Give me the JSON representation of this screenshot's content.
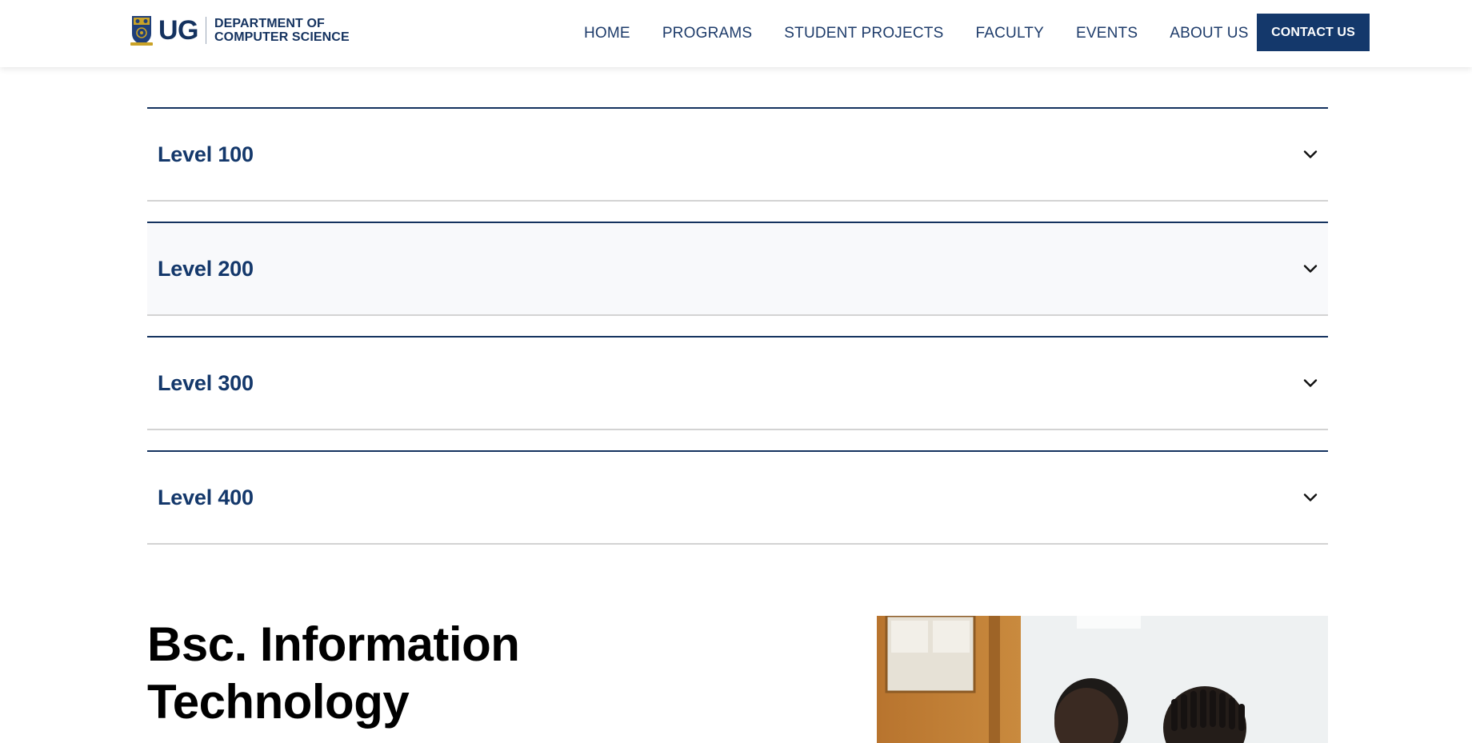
{
  "header": {
    "logo": {
      "abbr": "UG",
      "line1": "DEPARTMENT OF",
      "line2": "COMPUTER SCIENCE",
      "crest_icon": "university-crest-icon"
    },
    "nav": [
      {
        "label": "HOME"
      },
      {
        "label": "PROGRAMS"
      },
      {
        "label": "STUDENT PROJECTS"
      },
      {
        "label": "FACULTY"
      },
      {
        "label": "EVENTS"
      },
      {
        "label": "ABOUT US"
      }
    ],
    "cta_label": "CONTACT US"
  },
  "accordion": {
    "items": [
      {
        "label": "Level 100",
        "icon": "chevron-down-icon"
      },
      {
        "label": "Level 200",
        "icon": "chevron-down-icon"
      },
      {
        "label": "Level 300",
        "icon": "chevron-down-icon"
      },
      {
        "label": "Level 400",
        "icon": "chevron-down-icon"
      }
    ]
  },
  "program": {
    "title_line1": "Bsc. Information",
    "title_line2": "Technology",
    "photo": "students-photo"
  },
  "colors": {
    "brand_navy": "#14386b",
    "text_navy": "#1d3b6a",
    "divider_gray": "#d3d3d3",
    "hover_bg": "#f8f9fb"
  }
}
